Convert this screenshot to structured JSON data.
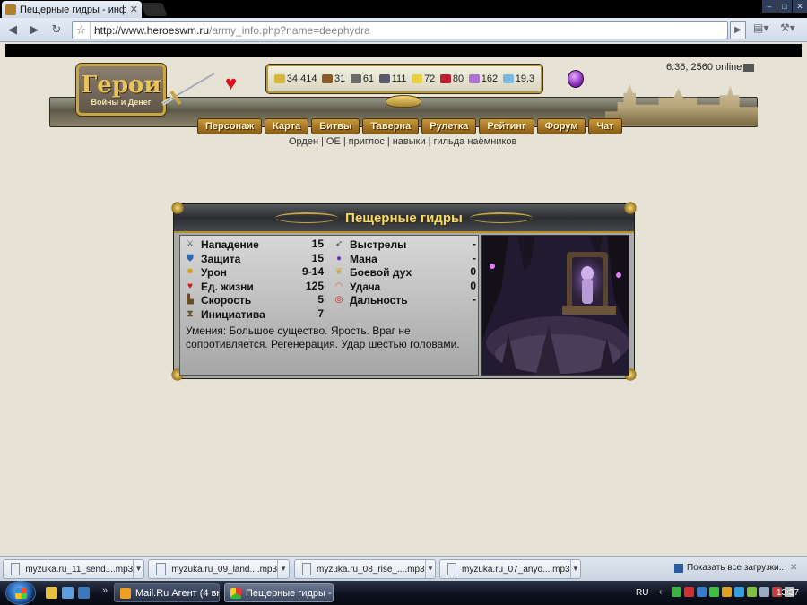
{
  "browser": {
    "tab_title": "Пещерные гидры - инф...",
    "url_host": "http://www.heroeswm.ru",
    "url_path": "/army_info.php?name=deephydra"
  },
  "header": {
    "logo_title": "Герои",
    "logo_subtitle": "Войны и Денег",
    "resources": [
      {
        "name": "gold",
        "value": "34,414",
        "color": "#d8b43a"
      },
      {
        "name": "wood",
        "value": "31",
        "color": "#8a5a2a"
      },
      {
        "name": "ore",
        "value": "61",
        "color": "#6a6a6a"
      },
      {
        "name": "mercury",
        "value": "111",
        "color": "#5a5a6a"
      },
      {
        "name": "sulfur",
        "value": "72",
        "color": "#e8d040"
      },
      {
        "name": "crystals",
        "value": "80",
        "color": "#c02030"
      },
      {
        "name": "gems",
        "value": "162",
        "color": "#b070d0"
      },
      {
        "name": "diamonds",
        "value": "19,3",
        "color": "#7ab8e0"
      }
    ],
    "online": "6:36, 2560 online",
    "nav": [
      "Персонаж",
      "Карта",
      "Битвы",
      "Таверна",
      "Рулетка",
      "Рейтинг",
      "Форум",
      "Чат"
    ],
    "sub_links": [
      "Орден",
      "ОЕ",
      "приглос",
      "навыки",
      "гильда наёмников"
    ]
  },
  "creature": {
    "title": "Пещерные гидры",
    "stats_left": [
      {
        "label": "Нападение",
        "value": "15",
        "icon": "attack-icon"
      },
      {
        "label": "Защита",
        "value": "15",
        "icon": "defense-icon"
      },
      {
        "label": "Урон",
        "value": "9-14",
        "icon": "damage-icon"
      },
      {
        "label": "Ед. жизни",
        "value": "125",
        "icon": "health-icon"
      },
      {
        "label": "Скорость",
        "value": "5",
        "icon": "speed-icon"
      },
      {
        "label": "Инициатива",
        "value": "7",
        "icon": "initiative-icon"
      }
    ],
    "stats_right": [
      {
        "label": "Выстрелы",
        "value": "-",
        "icon": "shots-icon"
      },
      {
        "label": "Мана",
        "value": "-",
        "icon": "mana-icon"
      },
      {
        "label": "Боевой дух",
        "value": "0",
        "icon": "morale-icon"
      },
      {
        "label": "Удача",
        "value": "0",
        "icon": "luck-icon"
      },
      {
        "label": "Дальность",
        "value": "-",
        "icon": "range-icon"
      }
    ],
    "skills": "Умения: Большое существо. Ярость. Враг не сопротивляется. Регенерация. Удар шестью головами."
  },
  "downloads": {
    "items": [
      "myzuka.ru_11_send....mp3",
      "myzuka.ru_09_land....mp3",
      "myzuka.ru_08_rise_....mp3",
      "myzuka.ru_07_anyo....mp3"
    ],
    "show_all": "Показать все загрузки..."
  },
  "taskbar": {
    "tasks": [
      "Mail.Ru Агент (4 вк...",
      "Пещерные гидры - ..."
    ],
    "lang": "RU",
    "clock": "13:37"
  }
}
